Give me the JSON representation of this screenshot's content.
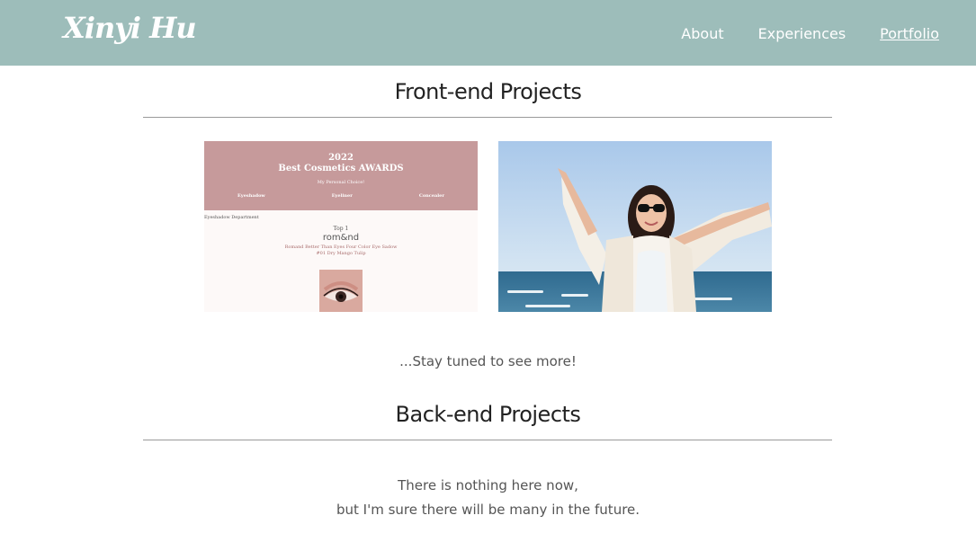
{
  "nav": {
    "logo": "Xinyi Hu",
    "links": [
      "About",
      "Experiences",
      "Portfolio"
    ],
    "active": "Portfolio"
  },
  "colors": {
    "nav_bg": "#9dbdba",
    "rule": "#9a9a9a",
    "cosmetics_header": "#c69a9b"
  },
  "frontend": {
    "title": "Front-end Projects",
    "projects": [
      {
        "kind": "cosmetics-awards-preview",
        "year": "2022",
        "heading": "Best Cosmetics AWARDS",
        "subheading": "My Personal Choice!",
        "tabs": [
          "Eyeshadow",
          "Eyeliner",
          "Concealer"
        ],
        "department": "Eyeshadow Department",
        "rank": "Top 1",
        "brand": "rom&nd",
        "product_line1": "Romand Better Than Eyes Four Color Eye Sadow",
        "product_line2": "#01 Dry Mango Tulip"
      },
      {
        "kind": "beach-photo-preview"
      }
    ],
    "footer_note": "...Stay tuned to see more!"
  },
  "backend": {
    "title": "Back-end Projects",
    "message_line1": "There is nothing here now,",
    "message_line2": "but I'm sure there will be many in the future."
  }
}
